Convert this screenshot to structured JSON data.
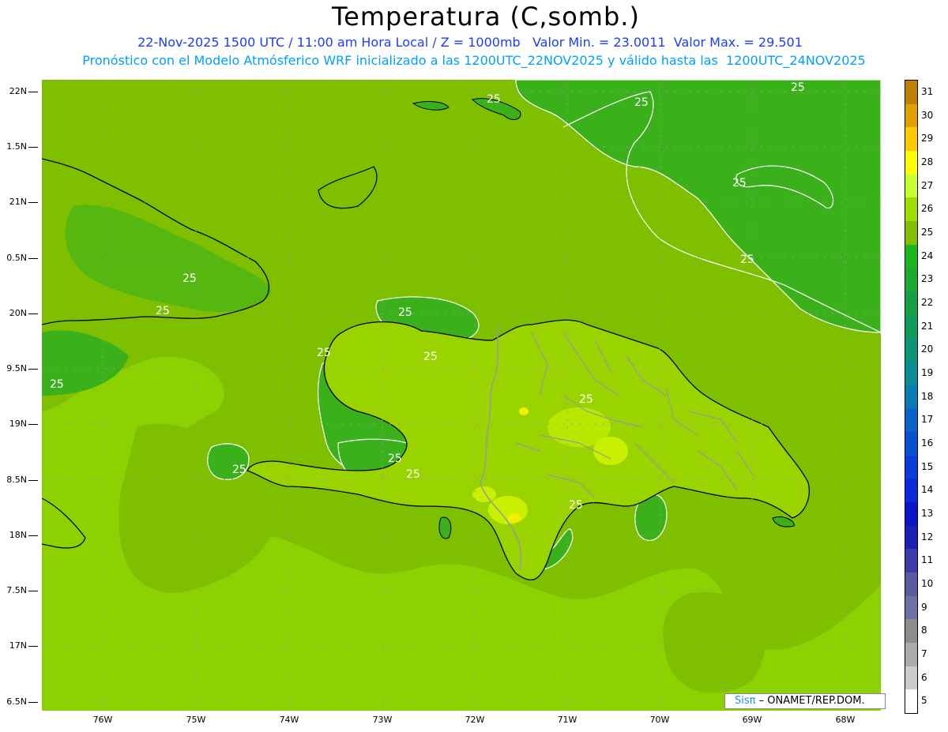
{
  "title": "Temperatura (C,somb.)",
  "subtitle1": "22-Nov-2025 1500 UTC / 11:00 am Hora Local / Z = 1000mb   Valor Min. = 23.0011  Valor Max. = 29.501",
  "subtitle2": "Pronóstico con el Modelo Atmósferico WRF inicializado a las 1200UTC_22NOV2025 y válido hasta las  1200UTC_24NOV2025",
  "lat_labels": [
    "22N",
    "1.5N",
    "21N",
    "0.5N",
    "20N",
    "9.5N",
    "19N",
    "8.5N",
    "18N",
    "7.5N",
    "17N",
    "6.5N"
  ],
  "lon_labels": [
    "76W",
    "75W",
    "74W",
    "73W",
    "72W",
    "71W",
    "70W",
    "69W",
    "68W"
  ],
  "contour_label": "25",
  "colorbar": {
    "labels": [
      "31",
      "30",
      "29",
      "28",
      "27",
      "26",
      "25",
      "24",
      "23",
      "22",
      "21",
      "20",
      "19",
      "18",
      "17",
      "16",
      "15",
      "14",
      "13",
      "12",
      "11",
      "10",
      "9",
      "8",
      "7",
      "6",
      "5"
    ],
    "colors": [
      "#c08000",
      "#e0a000",
      "#ffc800",
      "#ffff00",
      "#c8ff32",
      "#a0dc00",
      "#82be00",
      "#1eb41e",
      "#1eaa32",
      "#16a046",
      "#119a5a",
      "#0c9478",
      "#0a8c96",
      "#0a7ab4",
      "#0a64c8",
      "#0a50d2",
      "#0a3cdc",
      "#0a28dc",
      "#0a14c8",
      "#1e1eb4",
      "#3c3caa",
      "#5a5aa0",
      "#7070a8",
      "#8c8c8c",
      "#aaaaaa",
      "#cccccc",
      "#ffffff"
    ]
  },
  "credit": {
    "sis": "Sisπ",
    "rest": " – ONAMET/REP.DOM."
  },
  "colors": {
    "base_field": "#8cd200",
    "mid_field": "#7ec000",
    "cool_field": "#3ab01a",
    "warm_spot": "#c8f000",
    "hot_spot": "#f0f000"
  }
}
